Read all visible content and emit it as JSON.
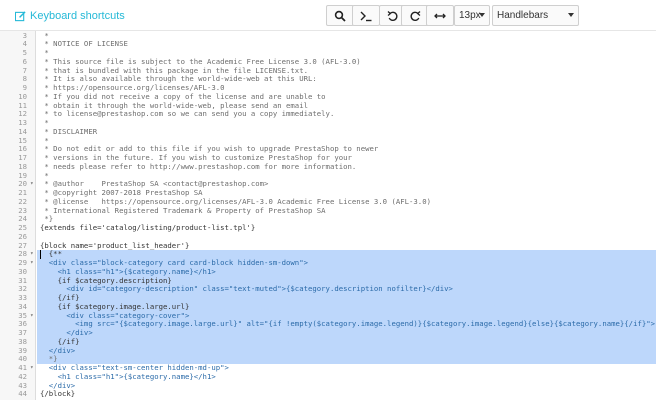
{
  "toolbar": {
    "keyboard_shortcuts": "Keyboard shortcuts",
    "font_size": "13px",
    "mode": "Handlebars",
    "buttons": [
      "search-icon",
      "terminal-icon",
      "undo-icon",
      "redo-icon",
      "expand-horizontal-icon"
    ]
  },
  "colors": {
    "accent": "#25b9d7",
    "selection": "#bdd7fb"
  },
  "editor": {
    "lines": [
      {
        "n": "3",
        "fold": "",
        "text": " *",
        "sel": false
      },
      {
        "n": "4",
        "fold": "",
        "text": " * NOTICE OF LICENSE",
        "sel": false
      },
      {
        "n": "5",
        "fold": "",
        "text": " *",
        "sel": false
      },
      {
        "n": "6",
        "fold": "",
        "text": " * This source file is subject to the Academic Free License 3.0 (AFL-3.0)",
        "sel": false
      },
      {
        "n": "7",
        "fold": "",
        "text": " * that is bundled with this package in the file LICENSE.txt.",
        "sel": false
      },
      {
        "n": "8",
        "fold": "",
        "text": " * It is also available through the world-wide-web at this URL:",
        "sel": false
      },
      {
        "n": "9",
        "fold": "",
        "text": " * https://opensource.org/licenses/AFL-3.0",
        "sel": false
      },
      {
        "n": "10",
        "fold": "",
        "text": " * If you did not receive a copy of the license and are unable to",
        "sel": false
      },
      {
        "n": "11",
        "fold": "",
        "text": " * obtain it through the world-wide-web, please send an email",
        "sel": false
      },
      {
        "n": "12",
        "fold": "",
        "text": " * to license@prestashop.com so we can send you a copy immediately.",
        "sel": false
      },
      {
        "n": "13",
        "fold": "",
        "text": " *",
        "sel": false
      },
      {
        "n": "14",
        "fold": "",
        "text": " * DISCLAIMER",
        "sel": false
      },
      {
        "n": "15",
        "fold": "",
        "text": " *",
        "sel": false
      },
      {
        "n": "16",
        "fold": "",
        "text": " * Do not edit or add to this file if you wish to upgrade PrestaShop to newer",
        "sel": false
      },
      {
        "n": "17",
        "fold": "",
        "text": " * versions in the future. If you wish to customize PrestaShop for your",
        "sel": false
      },
      {
        "n": "18",
        "fold": "",
        "text": " * needs please refer to http://www.prestashop.com for more information.",
        "sel": false
      },
      {
        "n": "19",
        "fold": "",
        "text": " *",
        "sel": false
      },
      {
        "n": "20",
        "fold": "▾",
        "text": " * @author    PrestaShop SA <contact@prestashop.com>",
        "sel": false
      },
      {
        "n": "21",
        "fold": "",
        "text": " * @copyright 2007-2018 PrestaShop SA",
        "sel": false
      },
      {
        "n": "22",
        "fold": "",
        "text": " * @license   https://opensource.org/licenses/AFL-3.0 Academic Free License 3.0 (AFL-3.0)",
        "sel": false
      },
      {
        "n": "23",
        "fold": "",
        "text": " * International Registered Trademark & Property of PrestaShop SA",
        "sel": false
      },
      {
        "n": "24",
        "fold": "",
        "text": " *}",
        "sel": false
      },
      {
        "n": "25",
        "fold": "",
        "text": "{extends file='catalog/listing/product-list.tpl'}",
        "sel": false
      },
      {
        "n": "26",
        "fold": "",
        "text": "",
        "sel": false
      },
      {
        "n": "27",
        "fold": "",
        "text": "{block name='product_list_header'}",
        "sel": false
      },
      {
        "n": "28",
        "fold": "▾",
        "text": "  {**",
        "sel": true
      },
      {
        "n": "29",
        "fold": "▾",
        "text": "  <div class=\"block-category card card-block hidden-sm-down\">",
        "sel": true
      },
      {
        "n": "30",
        "fold": "",
        "text": "    <h1 class=\"h1\">{$category.name}</h1>",
        "sel": true
      },
      {
        "n": "31",
        "fold": "",
        "text": "    {if $category.description}",
        "sel": true
      },
      {
        "n": "32",
        "fold": "",
        "text": "      <div id=\"category-description\" class=\"text-muted\">{$category.description nofilter}</div>",
        "sel": true
      },
      {
        "n": "33",
        "fold": "",
        "text": "    {/if}",
        "sel": true
      },
      {
        "n": "34",
        "fold": "",
        "text": "    {if $category.image.large.url}",
        "sel": true
      },
      {
        "n": "35",
        "fold": "▾",
        "text": "      <div class=\"category-cover\">",
        "sel": true
      },
      {
        "n": "36",
        "fold": "",
        "text": "        <img src=\"{$category.image.large.url}\" alt=\"{if !empty($category.image.legend)}{$category.image.legend}{else}{$category.name}{/if}\">",
        "sel": true
      },
      {
        "n": "37",
        "fold": "",
        "text": "      </div>",
        "sel": true
      },
      {
        "n": "38",
        "fold": "",
        "text": "    {/if}",
        "sel": true
      },
      {
        "n": "39",
        "fold": "",
        "text": "  </div>",
        "sel": true
      },
      {
        "n": "40",
        "fold": "",
        "text": "  *}",
        "sel": true
      },
      {
        "n": "41",
        "fold": "▾",
        "text": "  <div class=\"text-sm-center hidden-md-up\">",
        "sel": false
      },
      {
        "n": "42",
        "fold": "",
        "text": "    <h1 class=\"h1\">{$category.name}</h1>",
        "sel": false
      },
      {
        "n": "43",
        "fold": "",
        "text": "  </div>",
        "sel": false
      },
      {
        "n": "44",
        "fold": "",
        "text": "{/block}",
        "sel": false
      }
    ]
  }
}
